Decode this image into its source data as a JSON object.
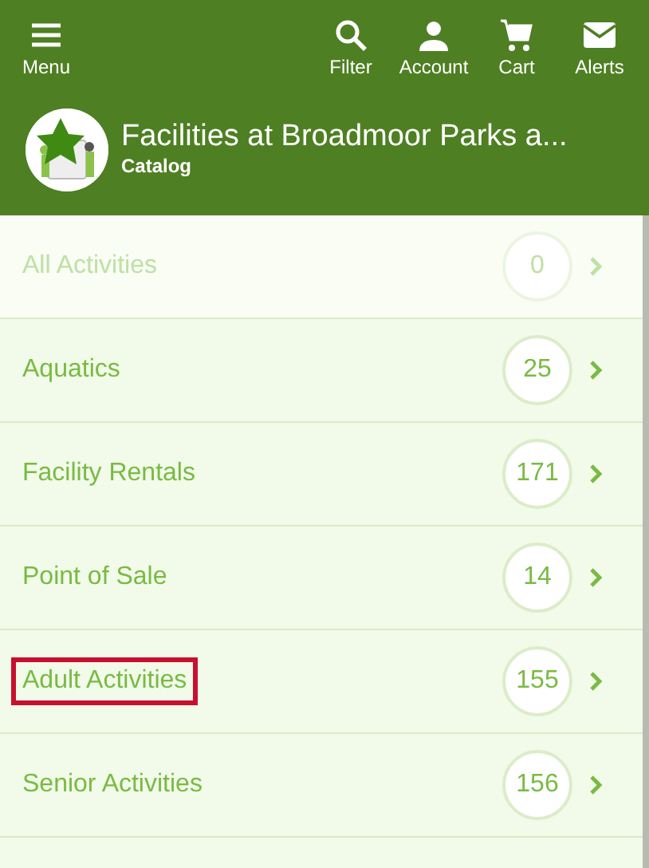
{
  "toolbar": {
    "menu": {
      "label": "Menu"
    },
    "actions": [
      {
        "kind": "filter",
        "label": "Filter"
      },
      {
        "kind": "account",
        "label": "Account"
      },
      {
        "kind": "cart",
        "label": "Cart"
      },
      {
        "kind": "alerts",
        "label": "Alerts"
      }
    ]
  },
  "header": {
    "title": "Facilities at Broadmoor Parks a...",
    "subtitle": "Catalog"
  },
  "categories": [
    {
      "name": "All Activities",
      "count": "0",
      "disabled": true,
      "highlighted": false
    },
    {
      "name": "Aquatics",
      "count": "25",
      "disabled": false,
      "highlighted": false
    },
    {
      "name": "Facility Rentals",
      "count": "171",
      "disabled": false,
      "highlighted": false
    },
    {
      "name": "Point of Sale",
      "count": "14",
      "disabled": false,
      "highlighted": false
    },
    {
      "name": "Adult Activities",
      "count": "155",
      "disabled": false,
      "highlighted": true
    },
    {
      "name": "Senior Activities",
      "count": "156",
      "disabled": false,
      "highlighted": false
    }
  ]
}
